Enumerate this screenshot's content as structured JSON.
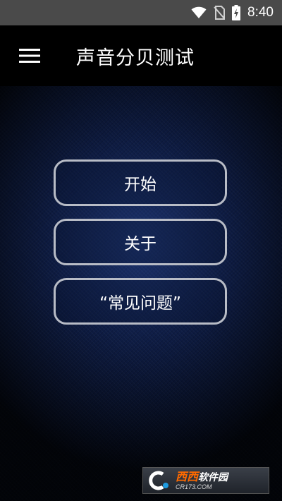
{
  "status_bar": {
    "time": "8:40",
    "icons": [
      "wifi-icon",
      "no-sim-icon",
      "battery-charging-icon"
    ]
  },
  "app_bar": {
    "menu_icon": "hamburger-menu-icon",
    "title": "声音分贝测试"
  },
  "main": {
    "buttons": [
      {
        "label": "开始"
      },
      {
        "label": "关于"
      },
      {
        "label": "“常见问题”"
      }
    ]
  },
  "watermark": {
    "brand": "西西",
    "suffix": "软件园",
    "url": "CR173.COM"
  },
  "colors": {
    "status_bar_bg": "#4a4a4a",
    "app_bar_bg": "#000000",
    "content_bg": "#0d1a3a",
    "button_border": "#b8bcc6",
    "watermark_accent": "#ff6a00"
  }
}
